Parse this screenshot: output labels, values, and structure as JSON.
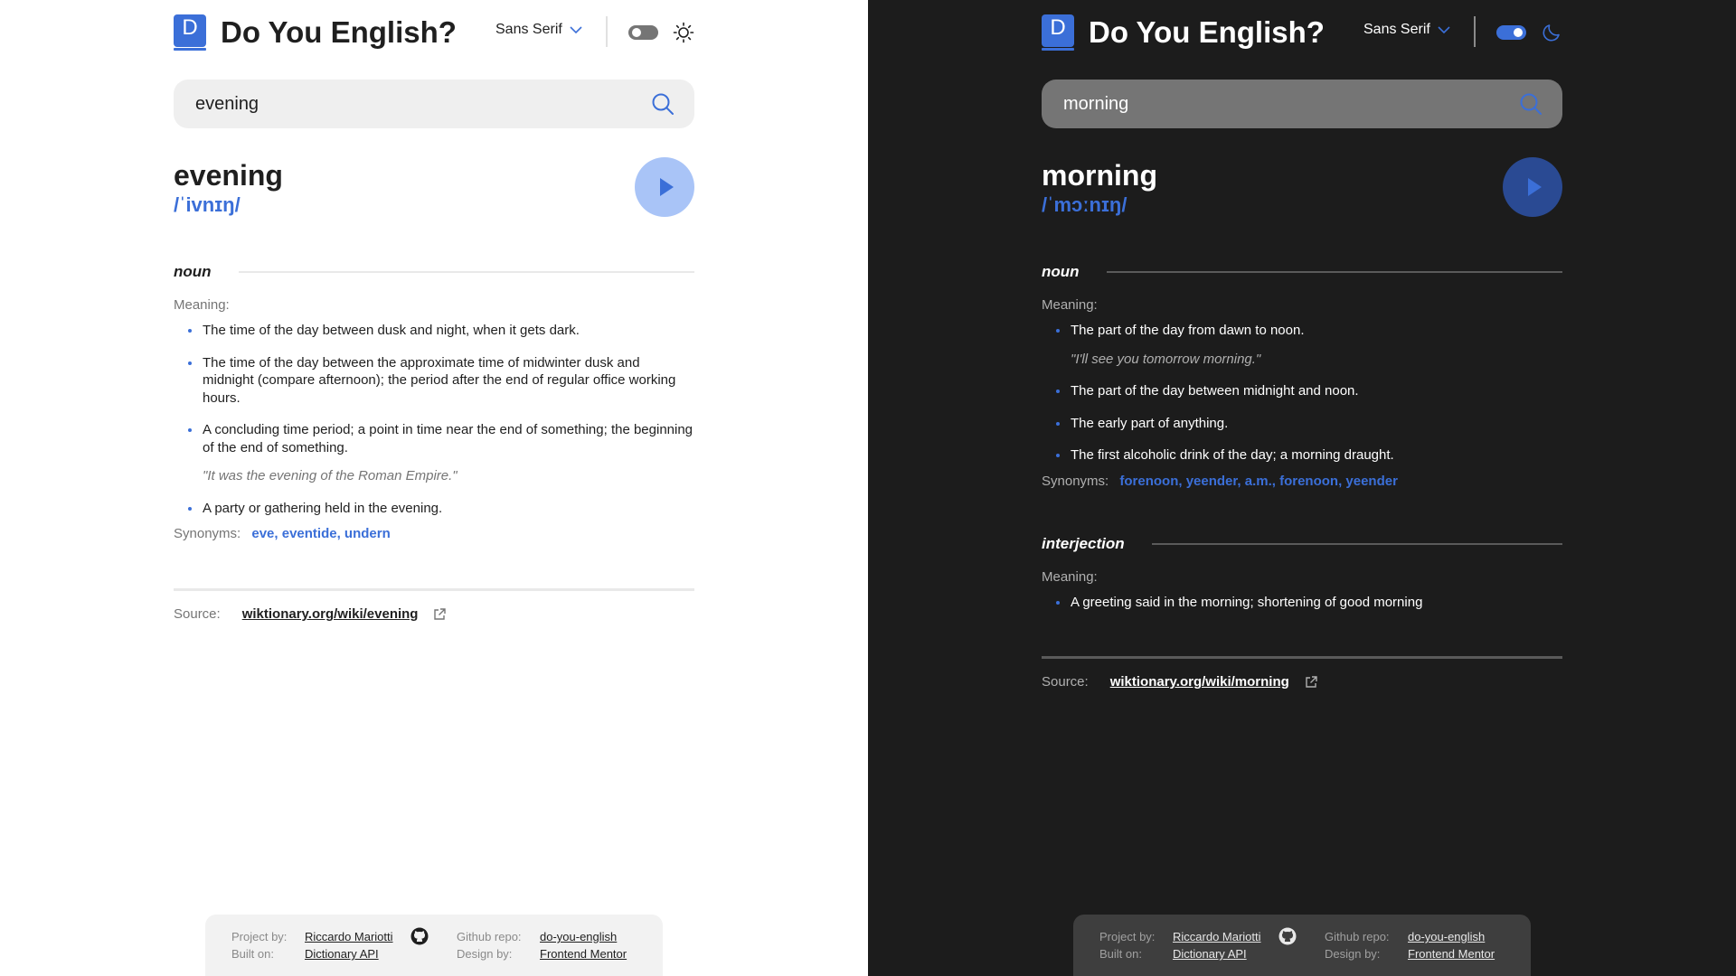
{
  "app": {
    "title": "Do You English?",
    "logo_letter": "D",
    "font_select": "Sans Serif",
    "accent": "#3b6fd8"
  },
  "light": {
    "theme": "light",
    "theme_icon": "sun-icon",
    "search_value": "evening",
    "word": "evening",
    "phonetic": "/ˈivnɪŋ/",
    "sections": [
      {
        "pos": "noun",
        "meaning_label": "Meaning:",
        "definitions": [
          {
            "text": "The time of the day between dusk and night, when it gets dark."
          },
          {
            "text": "The time of the day between the approximate time of midwinter dusk and midnight (compare afternoon); the period after the end of regular office working hours."
          },
          {
            "text": "A concluding time period; a point in time near the end of something; the beginning of the end of something.",
            "example": "\"It was the evening of the Roman Empire.\""
          },
          {
            "text": "A party or gathering held in the evening."
          }
        ],
        "synonyms_label": "Synonyms:",
        "synonyms": "eve, eventide, undern"
      }
    ],
    "source_label": "Source:",
    "source_link": "wiktionary.org/wiki/evening"
  },
  "dark": {
    "theme": "dark",
    "theme_icon": "moon-icon",
    "search_value": "morning",
    "word": "morning",
    "phonetic": "/ˈmɔːnɪŋ/",
    "sections": [
      {
        "pos": "noun",
        "meaning_label": "Meaning:",
        "definitions": [
          {
            "text": "The part of the day from dawn to noon.",
            "example": "\"I'll see you tomorrow morning.\""
          },
          {
            "text": "The part of the day between midnight and noon."
          },
          {
            "text": "The early part of anything."
          },
          {
            "text": "The first alcoholic drink of the day; a morning draught."
          }
        ],
        "synonyms_label": "Synonyms:",
        "synonyms": "forenoon, yeender, a.m., forenoon, yeender"
      },
      {
        "pos": "interjection",
        "meaning_label": "Meaning:",
        "definitions": [
          {
            "text": "A greeting said in the morning; shortening of good morning"
          }
        ]
      }
    ],
    "source_label": "Source:",
    "source_link": "wiktionary.org/wiki/morning"
  },
  "footer": {
    "project_label": "Project by:",
    "project_value": "Riccardo Mariotti",
    "built_label": "Built on:",
    "built_value": "Dictionary API",
    "repo_label": "Github repo:",
    "repo_value": "do-you-english",
    "design_label": "Design by:",
    "design_value": "Frontend Mentor"
  }
}
